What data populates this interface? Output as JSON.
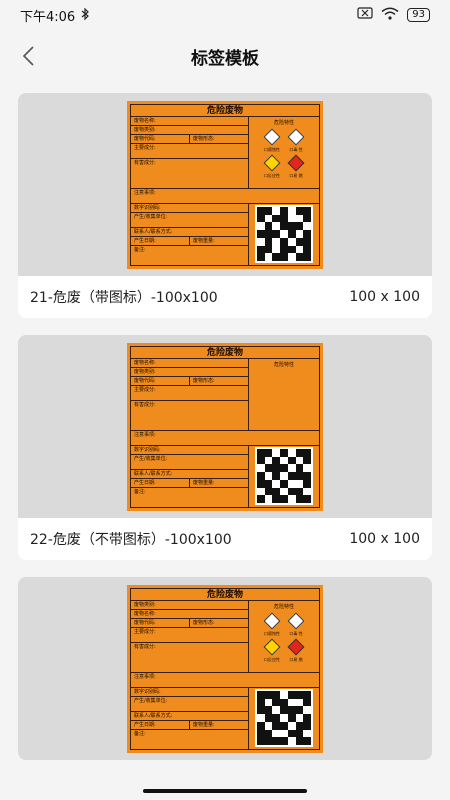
{
  "status_bar": {
    "time": "下午4:06",
    "bluetooth_icon": "bluetooth-icon",
    "sim_icon": "sim-off-icon",
    "wifi_icon": "wifi-icon",
    "battery": "93"
  },
  "header": {
    "title": "标签模板",
    "back_icon": "chevron-left-icon"
  },
  "label_text": {
    "title": "危险废物",
    "hazard_title": "危险特性",
    "fields": {
      "name": "废物名称:",
      "category": "废物类别:",
      "code": "废物代码:",
      "form": "废物形态:",
      "main": "主要成分:",
      "harmful": "有害成分:",
      "notice": "注意事项:",
      "digital_id": "数字识别码:",
      "producer": "产生/收集单位:",
      "contact": "联系人/联系方式:",
      "date": "产生日期:",
      "weight": "废物重量:",
      "remark": "备注:"
    },
    "hazards": [
      {
        "name": "口腐蚀性",
        "icon": "corrosive-icon",
        "color": "#ffffff"
      },
      {
        "name": "口毒 性",
        "icon": "toxic-icon",
        "color": "#ffffff"
      },
      {
        "name": "口反应性",
        "icon": "reactive-icon",
        "color": "#ffd400"
      },
      {
        "name": "口易 燃",
        "icon": "flammable-icon",
        "color": "#e3261d"
      }
    ]
  },
  "templates": [
    {
      "name": "21-危废（带图标）-100x100",
      "size": "100 x 100",
      "with_icons": true
    },
    {
      "name": "22-危废（不带图标）-100x100",
      "size": "100 x 100",
      "with_icons": false
    },
    {
      "name": "",
      "size": "",
      "with_icons": true
    }
  ],
  "colors": {
    "label_orange": "#f08c1d",
    "preview_bg": "#dadada",
    "page_bg": "#f4f4f4"
  }
}
